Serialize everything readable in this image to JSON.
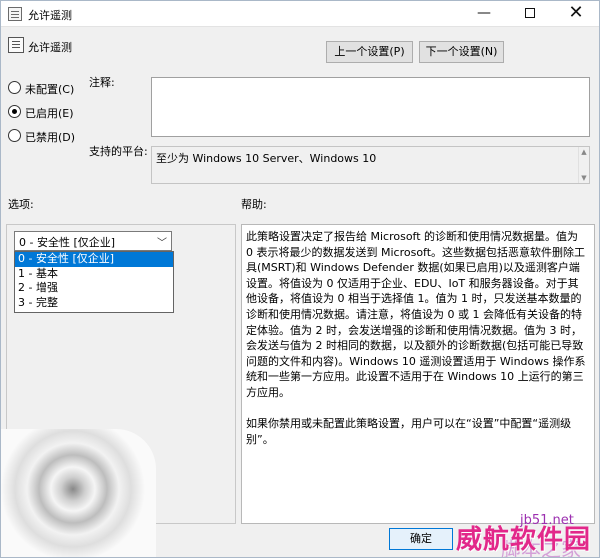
{
  "window": {
    "title": "允许遥测",
    "minimize_glyph": "—",
    "close_glyph": "✕"
  },
  "header": {
    "setting_name": "允许遥测",
    "prev_button": "上一个设置(P)",
    "next_button": "下一个设置(N)"
  },
  "state": {
    "options": [
      {
        "label": "未配置(C)",
        "checked": false
      },
      {
        "label": "已启用(E)",
        "checked": true
      },
      {
        "label": "已禁用(D)",
        "checked": false
      }
    ]
  },
  "comment": {
    "label": "注释:",
    "value": ""
  },
  "platform": {
    "label": "支持的平台:",
    "value": "至少为 Windows 10 Server、Windows 10"
  },
  "options_section": {
    "label": "选项:",
    "select_value": "0 - 安全性 [仅企业]",
    "dropdown_items": [
      "0 - 安全性 [仅企业]",
      "1 - 基本",
      "2 - 增强",
      "3 - 完整"
    ],
    "selected_index": 0
  },
  "help_section": {
    "label": "帮助:",
    "paragraphs": [
      "此策略设置决定了报告给 Microsoft 的诊断和使用情况数据量。值为 0 表示将最少的数据发送到 Microsoft。这些数据包括恶意软件删除工具(MSRT)和 Windows Defender 数据(如果已启用)以及遥测客户端设置。将值设为 0 仅适用于企业、EDU、IoT 和服务器设备。对于其他设备，将值设为 0 相当于选择值 1。值为 1 时，只发送基本数量的诊断和使用情况数据。请注意，将值设为 0 或 1 会降低有关设备的特定体验。值为 2 时，会发送增强的诊断和使用情况数据。值为 3 时，会发送与值为 2 时相同的数据，以及额外的诊断数据(包括可能已导致问题的文件和内容)。Windows 10 遥测设置适用于 Windows 操作系统和一些第一方应用。此设置不适用于在 Windows 10 上运行的第三方应用。",
      "如果你禁用或未配置此策略设置，用户可以在“设置”中配置“遥测级别”。"
    ]
  },
  "footer": {
    "ok_button": "确定"
  },
  "watermark": {
    "site": "jb51.net",
    "main_text": "威航软件园",
    "sub_text": "脚本之家"
  },
  "colors": {
    "selection": "#0078d7",
    "watermark_main": "#e2288a"
  }
}
